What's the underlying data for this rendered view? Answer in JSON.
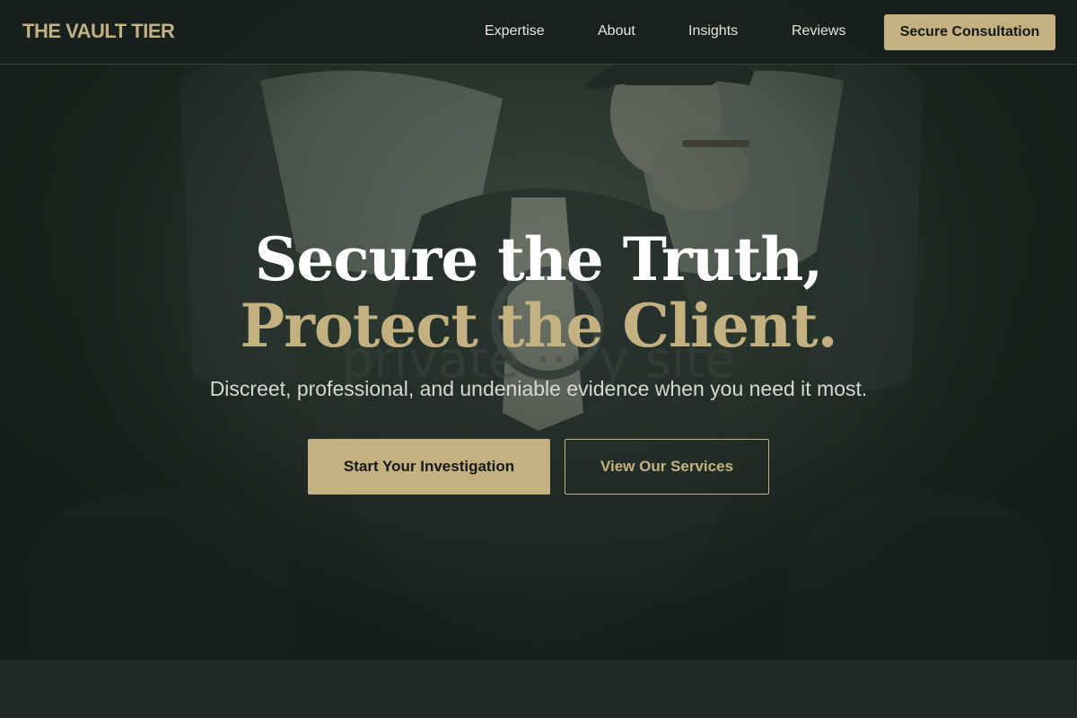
{
  "colors": {
    "accent": "#c4b182",
    "background": "#1c2822",
    "header_bg": "#18211c",
    "headline_white": "#ffffff",
    "body_text": "#d6d8d2"
  },
  "header": {
    "logo": "THE VAULT TIER",
    "nav": [
      {
        "label": "Expertise"
      },
      {
        "label": "About"
      },
      {
        "label": "Insights"
      },
      {
        "label": "Reviews"
      }
    ],
    "cta_label": "Secure Consultation"
  },
  "hero": {
    "background_image": "man-in-armchair-with-cigar-and-magnifying-glass",
    "headline_line1": "Secure the Truth,",
    "headline_line2": "Protect the Client.",
    "subheadline": "Discreet, professional, and undeniable evidence when you need it most.",
    "primary_button": "Start Your Investigation",
    "secondary_button": "View Our Services"
  }
}
